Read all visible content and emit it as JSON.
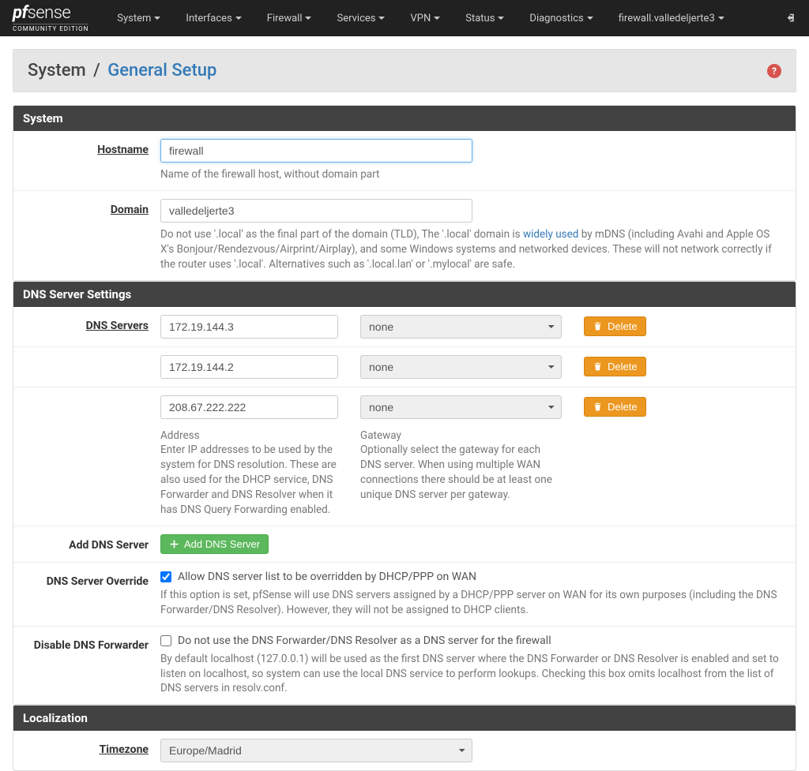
{
  "brand": {
    "logo": "pfsense",
    "edition": "COMMUNITY EDITION"
  },
  "nav": {
    "items": [
      "System",
      "Interfaces",
      "Firewall",
      "Services",
      "VPN",
      "Status",
      "Diagnostics"
    ],
    "hostname": "firewall.valledeljerte3"
  },
  "header": {
    "breadcrumb_root": "System",
    "page": "General Setup"
  },
  "panels": {
    "system": {
      "title": "System",
      "hostname": {
        "label": "Hostname",
        "value": "firewall",
        "help": "Name of the firewall host, without domain part"
      },
      "domain": {
        "label": "Domain",
        "value": "valledeljerte3",
        "help_pre": "Do not use '.local' as the final part of the domain (TLD), The '.local' domain is ",
        "help_link": "widely used",
        "help_post": " by mDNS (including Avahi and Apple OS X's Bonjour/Rendezvous/Airprint/Airplay), and some Windows systems and networked devices. These will not network correctly if the router uses '.local'. Alternatives such as '.local.lan' or '.mylocal' are safe."
      }
    },
    "dns": {
      "title": "DNS Server Settings",
      "servers_label": "DNS Servers",
      "rows": [
        {
          "address": "172.19.144.3",
          "gateway": "none",
          "delete": "Delete"
        },
        {
          "address": "172.19.144.2",
          "gateway": "none",
          "delete": "Delete"
        },
        {
          "address": "208.67.222.222",
          "gateway": "none",
          "delete": "Delete"
        }
      ],
      "address_title": "Address",
      "address_help": "Enter IP addresses to be used by the system for DNS resolution. These are also used for the DHCP service, DNS Forwarder and DNS Resolver when it has DNS Query Forwarding enabled.",
      "gateway_title": "Gateway",
      "gateway_help": "Optionally select the gateway for each DNS server. When using multiple WAN connections there should be at least one unique DNS server per gateway.",
      "add_label": "Add DNS Server",
      "add_button": "Add DNS Server",
      "override": {
        "label": "DNS Server Override",
        "checkbox": "Allow DNS server list to be overridden by DHCP/PPP on WAN",
        "checked": true,
        "help": "If this option is set, pfSense will use DNS servers assigned by a DHCP/PPP server on WAN for its own purposes (including the DNS Forwarder/DNS Resolver). However, they will not be assigned to DHCP clients."
      },
      "disable_forwarder": {
        "label": "Disable DNS Forwarder",
        "checkbox": "Do not use the DNS Forwarder/DNS Resolver as a DNS server for the firewall",
        "checked": false,
        "help": "By default localhost (127.0.0.1) will be used as the first DNS server where the DNS Forwarder or DNS Resolver is enabled and set to listen on localhost, so system can use the local DNS service to perform lookups. Checking this box omits localhost from the list of DNS servers in resolv.conf."
      }
    },
    "localization": {
      "title": "Localization",
      "timezone": {
        "label": "Timezone",
        "value": "Europe/Madrid"
      }
    }
  }
}
